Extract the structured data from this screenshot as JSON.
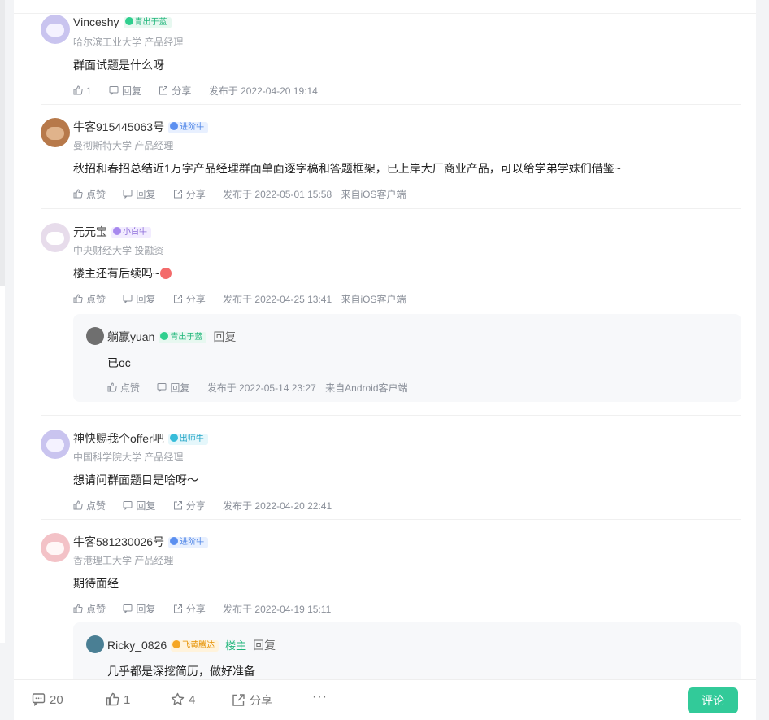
{
  "common": {
    "like": "点赞",
    "reply": "回复",
    "share": "分享"
  },
  "comments": [
    {
      "name": "Vinceshy",
      "badge": "青出于蓝",
      "school": "哈尔滨工业大学 产品经理",
      "content": "群面试题是什么呀",
      "likes": "1",
      "time": "发布于 2022-04-20 19:14",
      "client": ""
    },
    {
      "name": "牛客915445063号",
      "badge": "进阶牛",
      "school": "曼彻斯特大学 产品经理",
      "content": "秋招和春招总结近1万字产品经理群面单面逐字稿和答题框架，已上岸大厂商业产品，可以给学弟学妹们借鉴~",
      "likes": "点赞",
      "time": "发布于 2022-05-01 15:58",
      "client": "来自iOS客户端"
    },
    {
      "name": "元元宝",
      "badge": "小白牛",
      "school": "中央财经大学 投融资",
      "content": "楼主还有后续吗~",
      "likes": "点赞",
      "time": "发布于 2022-04-25 13:41",
      "client": "来自iOS客户端"
    },
    {
      "name": "神快赐我个offer吧",
      "badge": "出师牛",
      "school": "中国科学院大学 产品经理",
      "content": "想请问群面题目是啥呀～",
      "likes": "点赞",
      "time": "发布于 2022-04-20 22:41",
      "client": ""
    },
    {
      "name": "牛客581230026号",
      "badge": "进阶牛",
      "school": "香港理工大学 产品经理",
      "content": "期待面经",
      "likes": "点赞",
      "time": "发布于 2022-04-19 15:11",
      "client": ""
    }
  ],
  "replies": [
    {
      "name": "躺赢yuan",
      "badge": "青出于蓝",
      "owner": "",
      "reply_link": "回复",
      "content": "已oc",
      "time": "发布于 2022-05-14 23:27",
      "client": "来自Android客户端"
    },
    {
      "name": "Ricky_0826",
      "badge": "飞黄腾达",
      "owner": "楼主",
      "reply_link": "回复",
      "content": "几乎都是深挖简历，做好准备"
    }
  ],
  "bottom": {
    "comments": "20",
    "likes": "1",
    "stars": "4",
    "share": "分享",
    "more": "···",
    "comment_button": "评论"
  },
  "colors": {
    "accent": "#32ca99",
    "owner": "#1fb57a"
  }
}
